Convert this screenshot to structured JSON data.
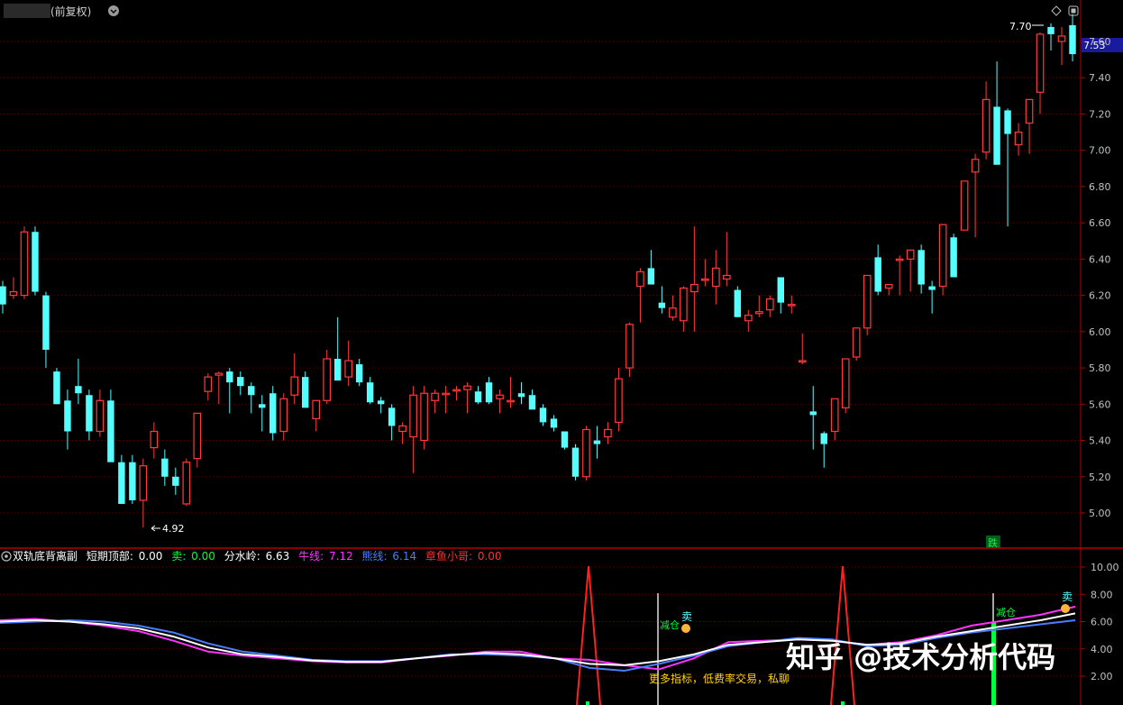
{
  "header": {
    "title_text": "(前复权)",
    "dropdown_icon": "chevron-down-icon",
    "diamond_icon": "diamond-icon",
    "window_icon": "maximize-icon"
  },
  "price_scale": {
    "current_price_label": "7.53",
    "ticks": [
      "7.60",
      "7.40",
      "7.20",
      "7.00",
      "6.80",
      "6.60",
      "6.40",
      "6.20",
      "6.00",
      "5.80",
      "5.60",
      "5.40",
      "5.20",
      "5.00"
    ]
  },
  "annotations": {
    "high_label": "7.70",
    "low_label": "4.92",
    "die_marker": "跌"
  },
  "indicator": {
    "name": "双轨底背离副",
    "fields": [
      {
        "label": "短期顶部:",
        "value": "0.00",
        "color": "#ffffff"
      },
      {
        "label": "卖:",
        "value": "0.00",
        "color": "#00ff3c"
      },
      {
        "label": "分水岭:",
        "value": "6.63",
        "color": "#ffffff"
      },
      {
        "label": "牛线:",
        "value": "7.12",
        "color": "#ff33ff"
      },
      {
        "label": "熊线:",
        "value": "6.14",
        "color": "#4a7dff"
      },
      {
        "label": "章鱼小哥:",
        "value": "0.00",
        "color": "#ff3030"
      }
    ],
    "scale_ticks": [
      "10.00",
      "8.00",
      "6.00",
      "4.00",
      "2.00"
    ],
    "markers": {
      "jiancang_1": "减仓",
      "mai_1": "卖",
      "jiancang_2": "减仓",
      "mai_2": "卖"
    },
    "promo_text": "更多指标，低费率交易，私聊",
    "watermark": "知乎 @技术分析代码"
  },
  "colors": {
    "up": "#ff3b3b",
    "down": "#54ffff",
    "grid": "#5a0000",
    "frame": "#b40000",
    "axis_text": "#c0c0c0",
    "bull": "#ff33ff",
    "bear": "#4a7dff",
    "watershed": "#ffffff",
    "signal": "#ff2020",
    "green": "#00ff3c"
  },
  "chart_data": [
    {
      "type": "candlestick",
      "title": "",
      "ylim": [
        4.85,
        7.75
      ],
      "y_ticks": [
        5.0,
        5.2,
        5.4,
        5.6,
        5.8,
        6.0,
        6.2,
        6.4,
        6.6,
        6.8,
        7.0,
        7.2,
        7.4,
        7.6
      ],
      "ohlc": [
        [
          6.25,
          6.28,
          6.1,
          6.15
        ],
        [
          6.2,
          6.3,
          6.18,
          6.22
        ],
        [
          6.2,
          6.58,
          6.18,
          6.55
        ],
        [
          6.55,
          6.58,
          6.2,
          6.22
        ],
        [
          6.2,
          6.22,
          5.8,
          5.9
        ],
        [
          5.78,
          5.8,
          5.6,
          5.6
        ],
        [
          5.62,
          5.68,
          5.35,
          5.45
        ],
        [
          5.7,
          5.85,
          5.6,
          5.66
        ],
        [
          5.65,
          5.68,
          5.4,
          5.45
        ],
        [
          5.45,
          5.68,
          5.42,
          5.62
        ],
        [
          5.62,
          5.68,
          5.3,
          5.28
        ],
        [
          5.28,
          5.32,
          5.05,
          5.05
        ],
        [
          5.28,
          5.32,
          5.05,
          5.07
        ],
        [
          5.07,
          5.3,
          4.92,
          5.26
        ],
        [
          5.36,
          5.5,
          5.3,
          5.45
        ],
        [
          5.3,
          5.35,
          5.15,
          5.2
        ],
        [
          5.2,
          5.25,
          5.1,
          5.15
        ],
        [
          5.05,
          5.3,
          5.04,
          5.28
        ],
        [
          5.3,
          5.55,
          5.25,
          5.55
        ],
        [
          5.67,
          5.77,
          5.62,
          5.75
        ],
        [
          5.76,
          5.78,
          5.6,
          5.77
        ],
        [
          5.78,
          5.8,
          5.55,
          5.72
        ],
        [
          5.75,
          5.78,
          5.65,
          5.7
        ],
        [
          5.7,
          5.72,
          5.55,
          5.65
        ],
        [
          5.6,
          5.65,
          5.45,
          5.58
        ],
        [
          5.66,
          5.7,
          5.4,
          5.44
        ],
        [
          5.45,
          5.66,
          5.4,
          5.63
        ],
        [
          5.65,
          5.88,
          5.6,
          5.75
        ],
        [
          5.75,
          5.78,
          5.6,
          5.58
        ],
        [
          5.52,
          5.62,
          5.45,
          5.62
        ],
        [
          5.62,
          5.9,
          5.6,
          5.85
        ],
        [
          5.85,
          6.08,
          5.8,
          5.73
        ],
        [
          5.75,
          5.95,
          5.7,
          5.84
        ],
        [
          5.82,
          5.85,
          5.7,
          5.72
        ],
        [
          5.72,
          5.75,
          5.6,
          5.61
        ],
        [
          5.62,
          5.64,
          5.55,
          5.6
        ],
        [
          5.58,
          5.6,
          5.4,
          5.48
        ],
        [
          5.45,
          5.5,
          5.38,
          5.48
        ],
        [
          5.42,
          5.7,
          5.22,
          5.65
        ],
        [
          5.4,
          5.7,
          5.35,
          5.66
        ],
        [
          5.62,
          5.68,
          5.55,
          5.66
        ],
        [
          5.66,
          5.7,
          5.55,
          5.66
        ],
        [
          5.68,
          5.7,
          5.62,
          5.68
        ],
        [
          5.68,
          5.72,
          5.55,
          5.7
        ],
        [
          5.67,
          5.7,
          5.6,
          5.61
        ],
        [
          5.72,
          5.75,
          5.6,
          5.61
        ],
        [
          5.63,
          5.68,
          5.55,
          5.65
        ],
        [
          5.62,
          5.75,
          5.58,
          5.62
        ],
        [
          5.66,
          5.72,
          5.6,
          5.64
        ],
        [
          5.65,
          5.68,
          5.58,
          5.57
        ],
        [
          5.58,
          5.6,
          5.48,
          5.5
        ],
        [
          5.52,
          5.54,
          5.45,
          5.47
        ],
        [
          5.45,
          5.45,
          5.35,
          5.36
        ],
        [
          5.36,
          5.38,
          5.18,
          5.2
        ],
        [
          5.2,
          5.48,
          5.18,
          5.46
        ],
        [
          5.4,
          5.48,
          5.3,
          5.38
        ],
        [
          5.42,
          5.5,
          5.38,
          5.46
        ],
        [
          5.5,
          5.8,
          5.45,
          5.74
        ],
        [
          5.8,
          6.05,
          5.75,
          6.04
        ],
        [
          6.25,
          6.35,
          6.05,
          6.33
        ],
        [
          6.35,
          6.45,
          6.3,
          6.26
        ],
        [
          6.16,
          6.25,
          6.1,
          6.13
        ],
        [
          6.08,
          6.2,
          6.06,
          6.13
        ],
        [
          6.06,
          6.25,
          6.0,
          6.24
        ],
        [
          6.22,
          6.58,
          6.0,
          6.26
        ],
        [
          6.29,
          6.4,
          6.25,
          6.29
        ],
        [
          6.25,
          6.45,
          6.15,
          6.35
        ],
        [
          6.29,
          6.55,
          6.25,
          6.31
        ],
        [
          6.23,
          6.25,
          6.08,
          6.08
        ],
        [
          6.06,
          6.12,
          6.0,
          6.09
        ],
        [
          6.1,
          6.2,
          6.08,
          6.11
        ],
        [
          6.12,
          6.2,
          6.08,
          6.18
        ],
        [
          6.3,
          6.3,
          6.1,
          6.16
        ],
        [
          6.15,
          6.2,
          6.1,
          6.15
        ],
        [
          5.84,
          5.99,
          5.82,
          5.84
        ],
        [
          5.56,
          5.7,
          5.35,
          5.54
        ],
        [
          5.44,
          5.45,
          5.25,
          5.38
        ],
        [
          5.45,
          5.58,
          5.4,
          5.63
        ],
        [
          5.58,
          5.85,
          5.55,
          5.85
        ],
        [
          5.86,
          6.0,
          5.84,
          6.02
        ],
        [
          6.02,
          6.3,
          5.98,
          6.31
        ],
        [
          6.41,
          6.48,
          6.2,
          6.22
        ],
        [
          6.24,
          6.25,
          6.2,
          6.26
        ],
        [
          6.4,
          6.42,
          6.2,
          6.4
        ],
        [
          6.4,
          6.45,
          6.22,
          6.45
        ],
        [
          6.45,
          6.48,
          6.21,
          6.26
        ],
        [
          6.25,
          6.28,
          6.1,
          6.23
        ],
        [
          6.25,
          6.3,
          6.2,
          6.59
        ],
        [
          6.52,
          6.54,
          6.3,
          6.3
        ],
        [
          6.56,
          6.55,
          6.55,
          6.83
        ],
        [
          6.88,
          6.98,
          6.52,
          6.95
        ],
        [
          6.99,
          7.38,
          6.95,
          7.28
        ],
        [
          7.24,
          7.49,
          6.93,
          6.92
        ],
        [
          7.22,
          7.23,
          6.58,
          7.09
        ],
        [
          7.03,
          7.15,
          6.97,
          7.1
        ],
        [
          7.15,
          7.27,
          6.98,
          7.28
        ],
        [
          7.32,
          7.65,
          7.2,
          7.64
        ],
        [
          7.68,
          7.7,
          7.55,
          7.64
        ],
        [
          7.6,
          7.68,
          7.47,
          7.63
        ],
        [
          7.69,
          7.75,
          7.49,
          7.53
        ]
      ]
    },
    {
      "type": "line",
      "title": "双轨底背离副",
      "ylim": [
        0,
        10.5
      ],
      "y_ticks": [
        2.0,
        4.0,
        6.0,
        8.0,
        10.0
      ],
      "series": [
        {
          "name": "牛线",
          "values": [
            6.1,
            6.2,
            6.0,
            5.7,
            5.3,
            4.6,
            3.8,
            3.5,
            3.3,
            3.1,
            3.0,
            3.0,
            3.3,
            3.5,
            3.8,
            3.8,
            3.3,
            3.2,
            2.8,
            2.5,
            3.3,
            4.5,
            4.6,
            4.7,
            4.6,
            4.3,
            4.5,
            5.0,
            5.7,
            6.1,
            6.5,
            7.1
          ]
        },
        {
          "name": "熊线",
          "values": [
            5.9,
            6.0,
            6.1,
            6.0,
            5.7,
            5.2,
            4.4,
            3.8,
            3.5,
            3.2,
            3.1,
            3.1,
            3.3,
            3.6,
            3.6,
            3.5,
            3.3,
            2.6,
            2.4,
            2.9,
            3.5,
            4.2,
            4.5,
            4.8,
            4.7,
            4.2,
            4.3,
            4.8,
            5.2,
            5.5,
            5.8,
            6.1
          ]
        },
        {
          "name": "分水岭",
          "values": [
            6.0,
            6.1,
            6.0,
            5.8,
            5.5,
            4.9,
            4.1,
            3.6,
            3.4,
            3.15,
            3.05,
            3.05,
            3.3,
            3.55,
            3.7,
            3.6,
            3.3,
            2.9,
            2.8,
            3.1,
            3.6,
            4.3,
            4.5,
            4.7,
            4.6,
            4.3,
            4.4,
            4.9,
            5.3,
            5.7,
            6.1,
            6.6
          ]
        }
      ]
    }
  ]
}
